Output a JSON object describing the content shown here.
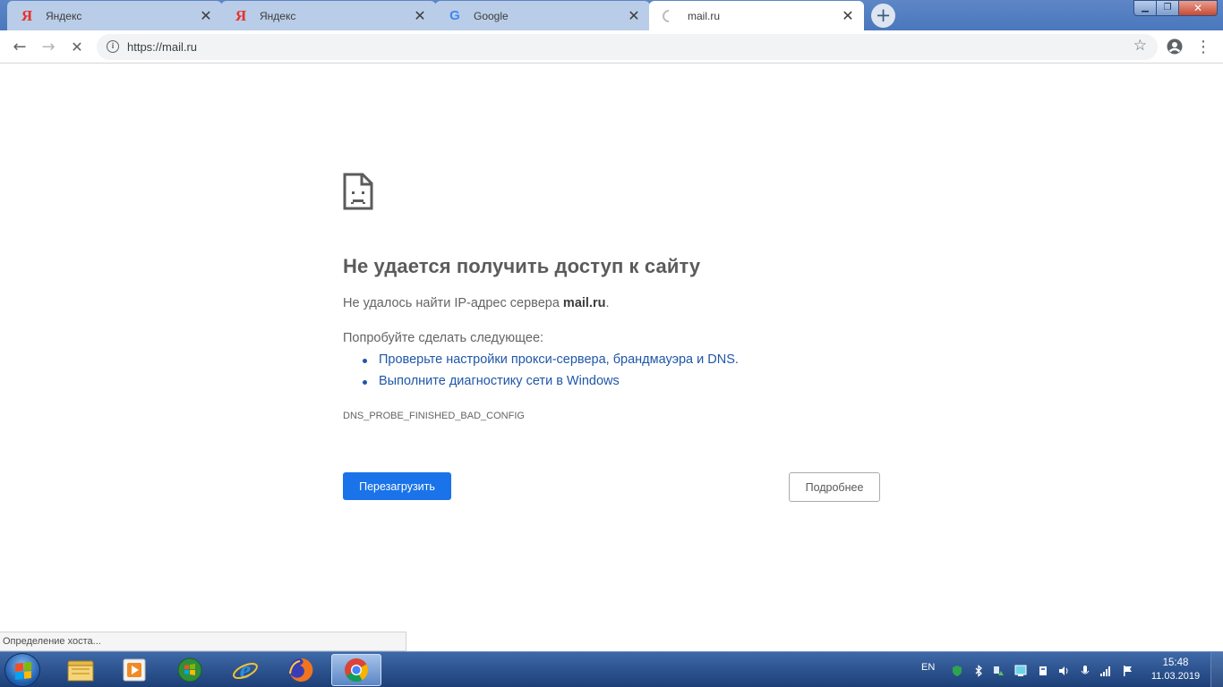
{
  "tabs": [
    {
      "title": "Яндекс",
      "favicon": "yandex-icon",
      "favicon_glyph": "Я",
      "active": false
    },
    {
      "title": "Яндекс",
      "favicon": "yandex-icon",
      "favicon_glyph": "Я",
      "active": false
    },
    {
      "title": "Google",
      "favicon": "google-icon",
      "favicon_glyph": "G",
      "active": false
    },
    {
      "title": "mail.ru",
      "favicon": "loading-spinner-icon",
      "favicon_glyph": "",
      "active": true
    }
  ],
  "tab_close_glyph": "✕",
  "new_tab_glyph": "+",
  "window_controls": {
    "minimize": "▁",
    "restore": "❐",
    "close": "✕"
  },
  "toolbar": {
    "back_glyph": "←",
    "forward_glyph": "→",
    "stop_glyph": "✕",
    "url": "https://mail.ru",
    "info_glyph": "i",
    "star_glyph": "☆",
    "menu_glyph": "⋮"
  },
  "error_page": {
    "title": "Не удается получить доступ к сайту",
    "message_prefix": "Не удалось найти IP-адрес сервера ",
    "message_host": "mail.ru",
    "message_suffix": ".",
    "try_heading": "Попробуйте сделать следующее:",
    "suggestions": [
      "Проверьте настройки прокси-сервера, брандмауэра и DNS.",
      "Выполните диагностику сети в Windows"
    ],
    "error_code": "DNS_PROBE_FINISHED_BAD_CONFIG",
    "reload_label": "Перезагрузить",
    "details_label": "Подробнее"
  },
  "status_bubble": "Определение хоста...",
  "taskbar": {
    "apps": [
      "explorer-icon",
      "media-player-icon",
      "media-center-icon",
      "internet-explorer-icon",
      "firefox-icon",
      "chrome-icon"
    ],
    "active_app": "chrome-icon",
    "language": "EN",
    "time": "15:48",
    "date": "11.03.2019"
  },
  "colors": {
    "accent": "#1a73e8",
    "link": "#1f56a8",
    "tab_strip": "#4a77bd"
  }
}
